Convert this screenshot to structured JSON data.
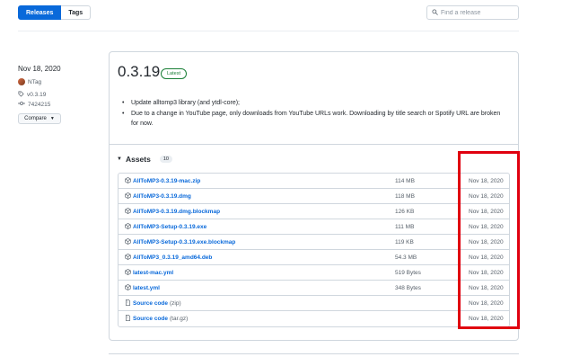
{
  "toolbar": {
    "releases_label": "Releases",
    "tags_label": "Tags",
    "search_placeholder": "Find a release"
  },
  "release_meta": {
    "date": "Nov 18, 2020",
    "author": "NTag",
    "tag": "v0.3.19",
    "commit": "7424215",
    "compare_label": "Compare"
  },
  "release": {
    "title": "0.3.19",
    "badge": "Latest",
    "notes": [
      "Update alltomp3 library (and ytdl-core);",
      "Due to a change in YouTube page, only downloads from YouTube URLs work. Downloading by title search or Spotify URL are broken for now."
    ]
  },
  "assets": {
    "title": "Assets",
    "count": "10",
    "items": [
      {
        "name": "AllToMP3-0.3.19-mac.zip",
        "suffix": "",
        "size": "114 MB",
        "date": "Nov 18, 2020",
        "icon": "package-icon"
      },
      {
        "name": "AllToMP3-0.3.19.dmg",
        "suffix": "",
        "size": "118 MB",
        "date": "Nov 18, 2020",
        "icon": "package-icon"
      },
      {
        "name": "AllToMP3-0.3.19.dmg.blockmap",
        "suffix": "",
        "size": "126 KB",
        "date": "Nov 18, 2020",
        "icon": "package-icon"
      },
      {
        "name": "AllToMP3-Setup-0.3.19.exe",
        "suffix": "",
        "size": "111 MB",
        "date": "Nov 18, 2020",
        "icon": "package-icon"
      },
      {
        "name": "AllToMP3-Setup-0.3.19.exe.blockmap",
        "suffix": "",
        "size": "119 KB",
        "date": "Nov 18, 2020",
        "icon": "package-icon"
      },
      {
        "name": "AllToMP3_0.3.19_amd64.deb",
        "suffix": "",
        "size": "54.3 MB",
        "date": "Nov 18, 2020",
        "icon": "package-icon"
      },
      {
        "name": "latest-mac.yml",
        "suffix": "",
        "size": "519 Bytes",
        "date": "Nov 18, 2020",
        "icon": "package-icon"
      },
      {
        "name": "latest.yml",
        "suffix": "",
        "size": "348 Bytes",
        "date": "Nov 18, 2020",
        "icon": "package-icon"
      },
      {
        "name": "Source code",
        "suffix": "(zip)",
        "size": "",
        "date": "Nov 18, 2020",
        "icon": "file-zip-icon"
      },
      {
        "name": "Source code",
        "suffix": "(tar.gz)",
        "size": "",
        "date": "Nov 18, 2020",
        "icon": "file-zip-icon"
      }
    ]
  },
  "colors": {
    "accent": "#0969da",
    "latest_green": "#1a7f37",
    "highlight_red": "#e0000f"
  }
}
